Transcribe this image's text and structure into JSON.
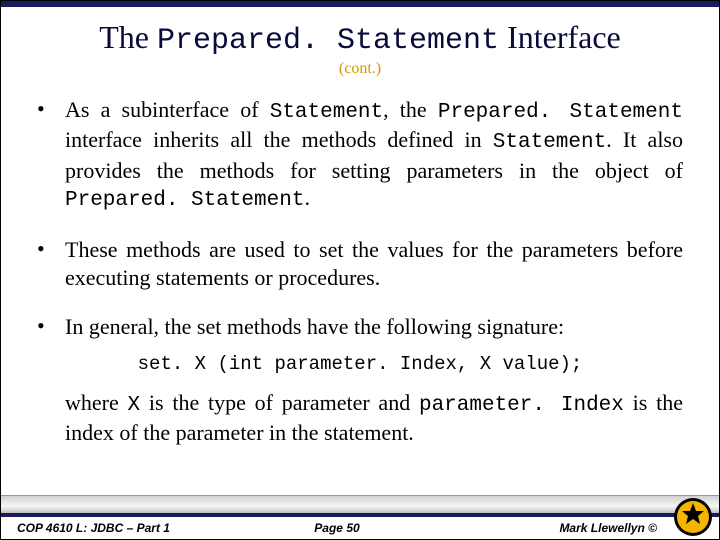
{
  "title": {
    "p1": "The ",
    "mono": "Prepared. Statement",
    "p3": " Interface",
    "sub": "(cont.)"
  },
  "bullets": {
    "b1": {
      "t1": "As a subinterface of ",
      "m1": "Statement",
      "t2": ", the ",
      "m2": "Prepared. Statement",
      "t3": " interface inherits all the methods defined in ",
      "m3": "Statement",
      "t4": ". It also provides the methods for setting parameters in the object of ",
      "m4": "Prepared. Statement",
      "t5": "."
    },
    "b2": "These methods are used to set the values for the parameters before executing statements or procedures.",
    "b3": "In general, the set methods have the following signature:"
  },
  "sig": "set. X (int parameter. Index, X value);",
  "where": {
    "t1": "where ",
    "m1": "X",
    "t2": " is the type of parameter and ",
    "m2": "parameter. Index",
    "t3": " is the index of the parameter in the statement."
  },
  "footer": {
    "left": "COP 4610 L: JDBC – Part 1",
    "center": "Page 50",
    "right": "Mark Llewellyn ©"
  },
  "colors": {
    "navy": "#1a1a5c",
    "gold": "#d49b00"
  }
}
